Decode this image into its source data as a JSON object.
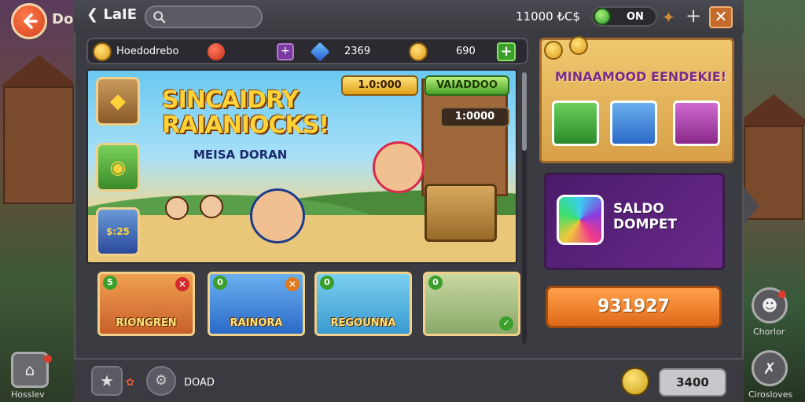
{
  "header": {
    "side_label": "Do",
    "back_title": "LaIE",
    "coins_text": "11000 ₺C$",
    "toggle_label": "ON"
  },
  "resources": {
    "player_name": "Hoedodrebo",
    "gems": "2369",
    "coins": "690"
  },
  "banner": {
    "headline_line1": "SINCAIDRY",
    "headline_line2": "RAIANIOCKS!",
    "subline": "MEISA DORAN",
    "price_gold": "1.0:000",
    "price_green": "VAIADDOO",
    "price_dark": "1:0000",
    "side_button_3": "$:25"
  },
  "cards": [
    {
      "badge": "5",
      "label": "RIONGREN"
    },
    {
      "badge": "0",
      "label": "RAINORA"
    },
    {
      "badge": "0",
      "label": "REGOUNNA"
    },
    {
      "badge": "0",
      "label": ""
    }
  ],
  "promo": {
    "title": "MINAAMOOD EENDEKIE!"
  },
  "saldo": {
    "line1": "SALDO",
    "line2": "DOMPET"
  },
  "action_button": "931927",
  "bottom": {
    "label": "DOAD",
    "value": "3400"
  },
  "outer": {
    "left_bottom_label": "Hosslev",
    "right_mid_label": "Chorlor",
    "right_bottom_label": "Cirosloves"
  },
  "colors": {
    "accent_orange": "#e06a1a",
    "gold": "#ffd23a",
    "panel": "#3b3b42"
  }
}
